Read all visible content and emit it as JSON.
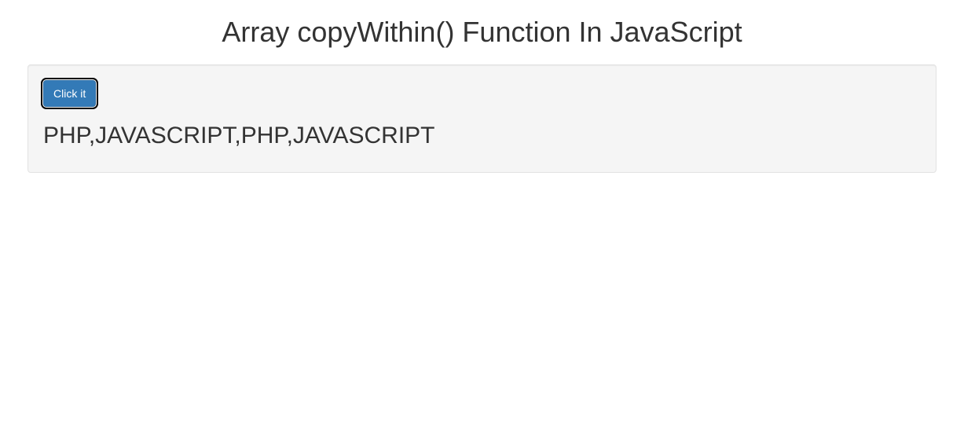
{
  "page": {
    "title": "Array copyWithin() Function In JavaScript"
  },
  "button": {
    "label": "Click it"
  },
  "output": {
    "text": "PHP,JAVASCRIPT,PHP,JAVASCRIPT"
  }
}
